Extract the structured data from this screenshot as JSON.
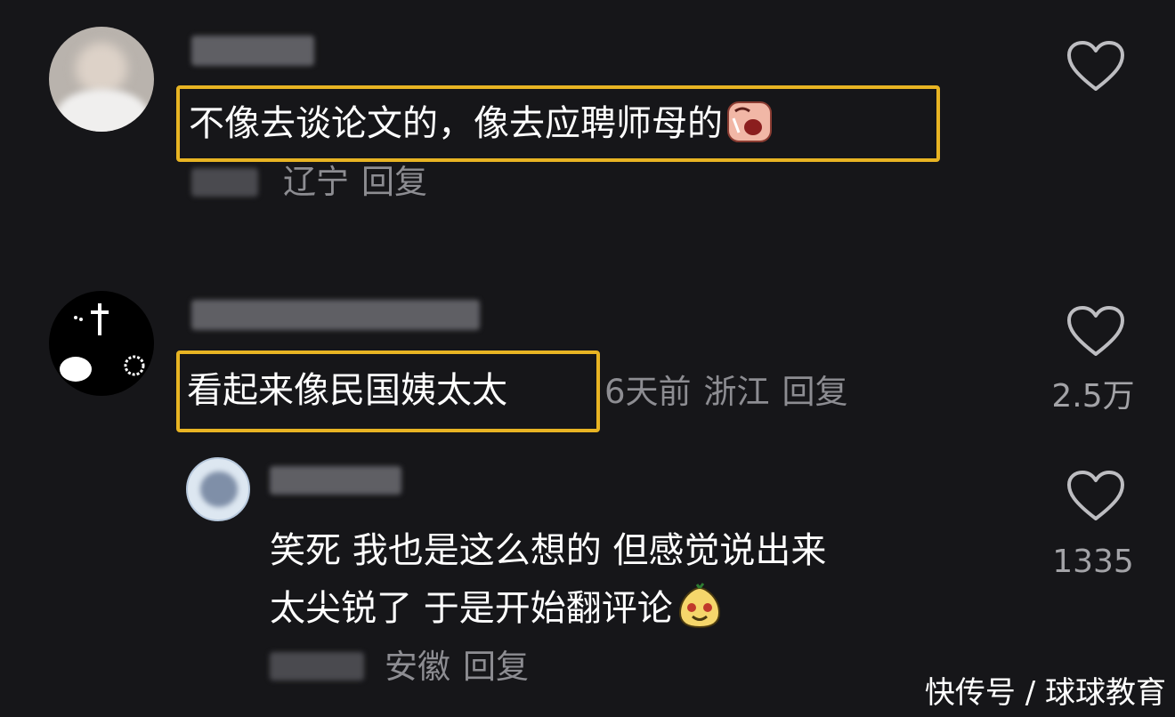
{
  "comments": [
    {
      "text": "不像去谈论文的，像去应聘师母的",
      "location": "辽宁",
      "reply_label": "回复"
    },
    {
      "text": "看起来像民国姨太太",
      "time": "6天前",
      "location": "浙江",
      "reply_label": "回复",
      "likes": "2.5万"
    }
  ],
  "reply": {
    "text_line1": "笑死 我也是这么想的 但感觉说出来",
    "text_line2": "太尖锐了 于是开始翻评论",
    "location": "安徽",
    "reply_label": "回复",
    "likes": "1335"
  },
  "watermark": "快传号 / 球球教育",
  "colors": {
    "background": "#161619",
    "highlight_border": "#e8b423",
    "meta_text": "#8d8d92"
  }
}
